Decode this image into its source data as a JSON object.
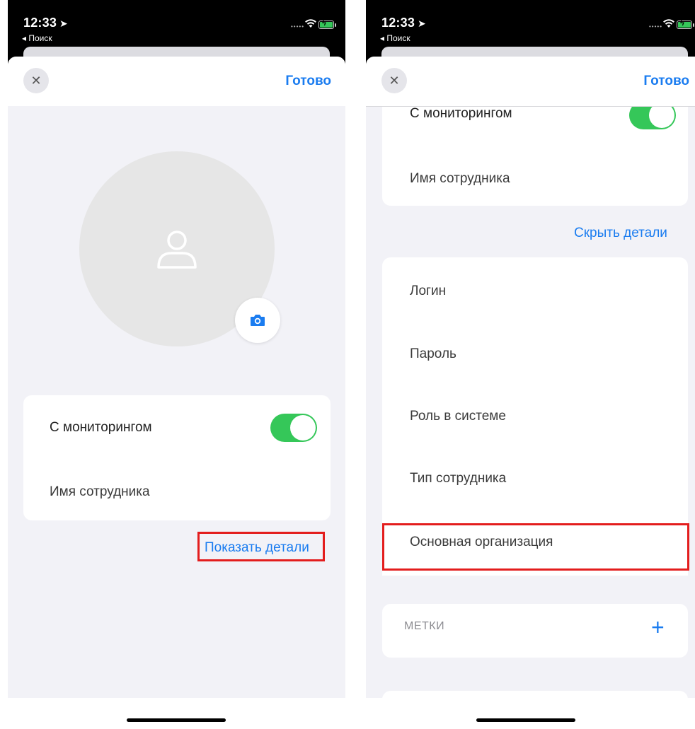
{
  "status": {
    "time": "12:33",
    "back_label": "◂ Поиск"
  },
  "nav": {
    "close_symbol": "✕",
    "done_label": "Готово"
  },
  "left": {
    "monitoring_label": "С мониторингом",
    "monitoring_on": true,
    "employee_name_placeholder": "Имя сотрудника",
    "show_details_label": "Показать детали"
  },
  "right": {
    "monitoring_label": "С мониторингом",
    "employee_name_placeholder": "Имя сотрудника",
    "hide_details_label": "Скрыть детали",
    "fields": [
      "Логин",
      "Пароль",
      "Роль в системе",
      "Тип сотрудника",
      "Основная организация"
    ],
    "tags_label": "МЕТКИ",
    "add_symbol": "+"
  },
  "colors": {
    "accent": "#1a7cf0",
    "toggle_on": "#35c759",
    "highlight": "#e31d1d",
    "background": "#f2f2f7"
  },
  "icons": {
    "avatar": "person-icon",
    "camera": "camera-icon",
    "close": "close-icon",
    "add": "plus-icon"
  }
}
